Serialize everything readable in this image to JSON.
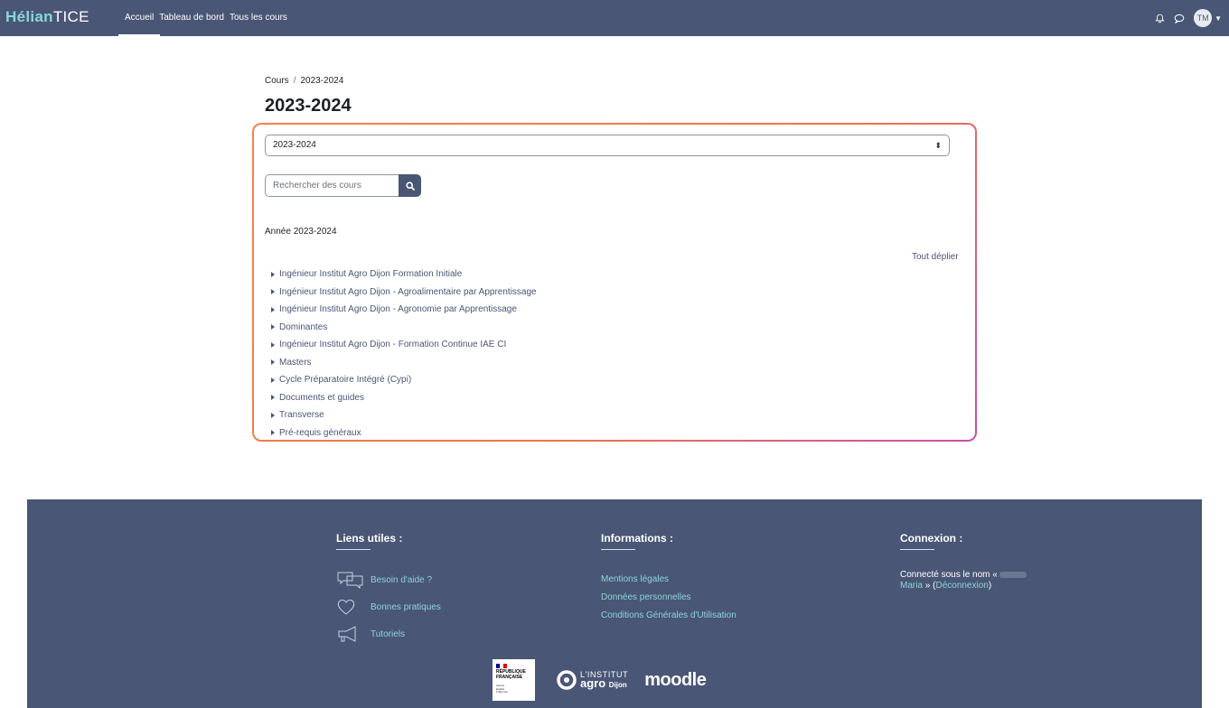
{
  "brand": {
    "part1": "Hélian",
    "part2": "TICE"
  },
  "nav": {
    "links": [
      {
        "label": "Accueil",
        "active": true
      },
      {
        "label": "Tableau de bord"
      },
      {
        "label": "Tous les cours"
      }
    ],
    "user_initials": "TM"
  },
  "breadcrumb": {
    "root": "Cours",
    "separator": "/",
    "current": "2023-2024"
  },
  "page_title": "2023-2024",
  "category_select": {
    "value": "2023-2024"
  },
  "search": {
    "placeholder": "Rechercher des cours"
  },
  "year_heading": "Année 2023-2024",
  "expand_all": "Tout déplier",
  "courses": [
    "Ingénieur Institut Agro Dijon Formation Initiale",
    "Ingénieur Institut Agro Dijon - Agroalimentaire par Apprentissage",
    "Ingénieur Institut Agro Dijon - Agronomie par Apprentissage",
    "Dominantes",
    "Ingénieur Institut Agro Dijon - Formation Continue IAE CI",
    "Masters",
    "Cycle Préparatoire Intégré (Cypi)",
    "Documents et guides",
    "Transverse",
    "Pré-requis généraux"
  ],
  "footer": {
    "useful_links": {
      "title": "Liens utiles :",
      "items": [
        {
          "label": "Besoin d'aide ?",
          "icon": "chat-bubbles-icon"
        },
        {
          "label": "Bonnes pratiques",
          "icon": "heart-icon"
        },
        {
          "label": "Tutoriels",
          "icon": "megaphone-icon"
        }
      ]
    },
    "information": {
      "title": "Informations :",
      "items": [
        "Mentions légales",
        "Données personnelles",
        "Conditions Générales d'Utilisation"
      ]
    },
    "login": {
      "title": "Connexion :",
      "prefix": "Connecté sous le nom «",
      "name": "Maria",
      "suffix": "» (",
      "logout": "Déconnexion",
      "close": ")"
    },
    "logos": {
      "rf": {
        "line1": "RÉPUBLIQUE",
        "line2": "FRANÇAISE",
        "motto1": "Liberté",
        "motto2": "Égalité",
        "motto3": "Fraternité"
      },
      "agro": {
        "line1": "L'INSTITUT",
        "line2": "agro",
        "line3": "Dijon"
      },
      "moodle": "moodle"
    }
  },
  "colors": {
    "navbar": "#4a5675",
    "accent": "#8ad6d9",
    "highlight_border": "#f0734c"
  }
}
